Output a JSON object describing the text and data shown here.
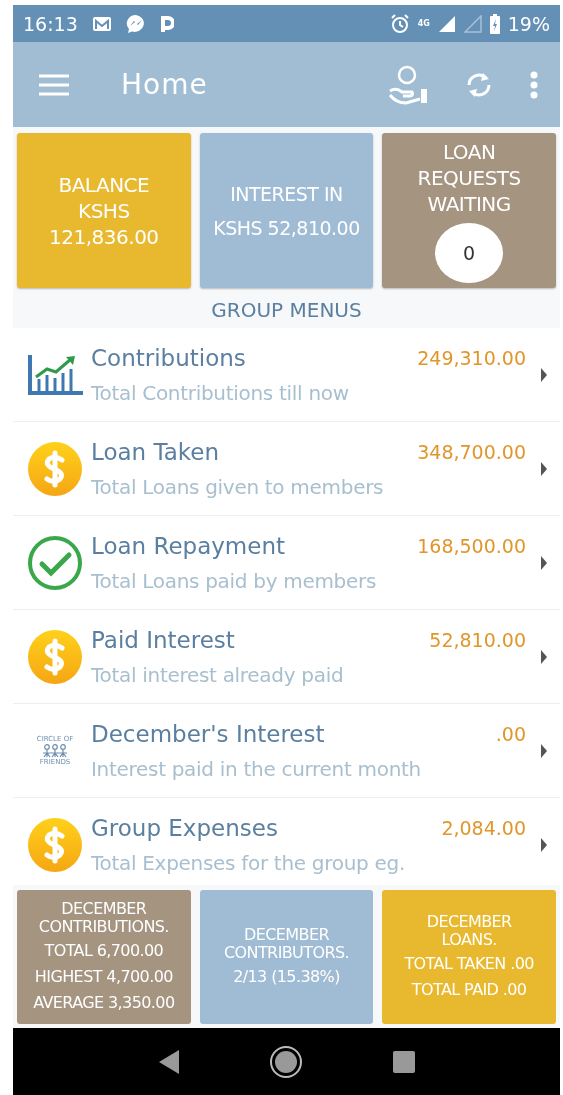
{
  "status_bar": {
    "time": "16:13",
    "network": "4G",
    "battery": "19%"
  },
  "app_bar": {
    "title": "Home"
  },
  "top_tiles": [
    {
      "color": "#e8b92e",
      "lines": [
        "BALANCE",
        "KSHS",
        "121,836.00"
      ]
    },
    {
      "color": "#a0bcd4",
      "lines": [
        "INTEREST IN",
        "KSHS 52,810.00"
      ]
    },
    {
      "color": "#a49480",
      "lines": [
        "LOAN",
        "REQUESTS",
        "WAITING"
      ],
      "badge": "0"
    }
  ],
  "section_title": "GROUP MENUS",
  "menu_items": [
    {
      "kind": "chart",
      "title": "Contributions",
      "subtitle": "Total Contributions till now",
      "amount": "249,310.00"
    },
    {
      "kind": "dollar",
      "title": "Loan Taken",
      "subtitle": "Total Loans given to members",
      "amount": "348,700.00"
    },
    {
      "kind": "check",
      "title": "Loan Repayment",
      "subtitle": "Total Loans paid by members",
      "amount": "168,500.00"
    },
    {
      "kind": "dollar",
      "title": "Paid Interest",
      "subtitle": "Total interest already paid",
      "amount": "52,810.00"
    },
    {
      "kind": "logo",
      "logo_top": "CIRCLE OF",
      "logo_bottom": "FRIENDS",
      "title": "December's Interest",
      "subtitle": "Interest paid in the current month",
      "amount": ".00"
    },
    {
      "kind": "dollar",
      "title": "Group Expenses",
      "subtitle": "Total Expenses for the group eg.",
      "amount": "2,084.00"
    }
  ],
  "bottom_tiles": [
    {
      "color": "#a49480",
      "heading": [
        "DECEMBER",
        "CONTRIBUTIONS."
      ],
      "lines": [
        "TOTAL 6,700.00",
        "HIGHEST 4,700.00",
        "AVERAGE 3,350.00"
      ]
    },
    {
      "color": "#a0bcd4",
      "heading": [
        "DECEMBER",
        "CONTRIBUTORS."
      ],
      "lines": [
        "2/13 (15.38%)"
      ]
    },
    {
      "color": "#e8b92e",
      "heading": [
        "DECEMBER",
        "LOANS."
      ],
      "lines": [
        "TOTAL TAKEN .00",
        "TOTAL PAID .00"
      ]
    }
  ]
}
